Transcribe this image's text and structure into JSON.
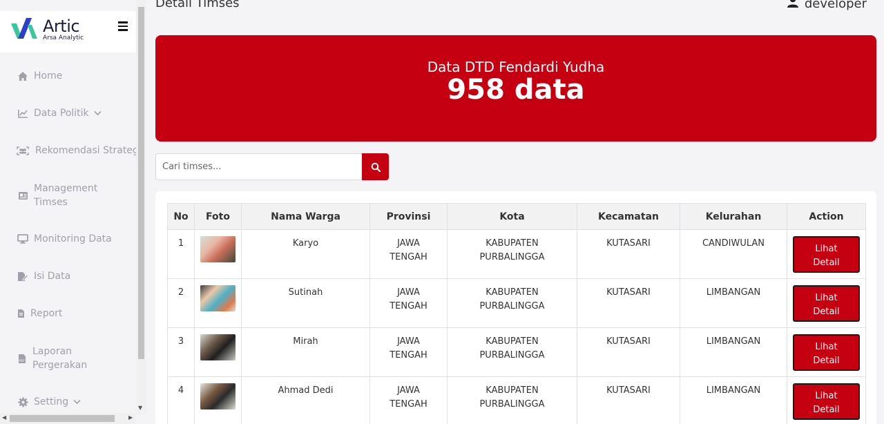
{
  "brand": {
    "name": "Artic",
    "subtitle": "Arsa Analytic"
  },
  "sidebar": {
    "items": [
      {
        "label": "Home",
        "icon": "home-icon"
      },
      {
        "label": "Data Politik",
        "icon": "chart-line-icon",
        "has_dropdown": true
      },
      {
        "label": "Rekomendasi Strategi",
        "icon": "users-scan-icon"
      },
      {
        "label": "Management Timses",
        "icon": "id-card-icon"
      },
      {
        "label": "Monitoring Data",
        "icon": "monitor-icon"
      },
      {
        "label": "Isi Data",
        "icon": "file-edit-icon"
      },
      {
        "label": "Report",
        "icon": "file-icon"
      },
      {
        "label": "Laporan Pergerakan",
        "icon": "pdf-file-icon"
      },
      {
        "label": "Setting",
        "icon": "gear-icon",
        "has_dropdown": true
      }
    ]
  },
  "header": {
    "title": "Detail Timses",
    "user": "developer"
  },
  "banner": {
    "title": "Data DTD Fendardi Yudha",
    "count": "958 data"
  },
  "search": {
    "placeholder": "Cari timses..."
  },
  "table": {
    "headers": [
      "No",
      "Foto",
      "Nama Warga",
      "Provinsi",
      "Kota",
      "Kecamatan",
      "Kelurahan",
      "Action"
    ],
    "rows": [
      {
        "no": "1",
        "nama": "Karyo",
        "provinsi": "JAWA TENGAH",
        "kota": "KABUPATEN PURBALINGGA",
        "kecamatan": "KUTASARI",
        "kelurahan": "CANDIWULAN",
        "action": "Lihat Detail"
      },
      {
        "no": "2",
        "nama": "Sutinah",
        "provinsi": "JAWA TENGAH",
        "kota": "KABUPATEN PURBALINGGA",
        "kecamatan": "KUTASARI",
        "kelurahan": "LIMBANGAN",
        "action": "Lihat Detail"
      },
      {
        "no": "3",
        "nama": "Mirah",
        "provinsi": "JAWA TENGAH",
        "kota": "KABUPATEN PURBALINGGA",
        "kecamatan": "KUTASARI",
        "kelurahan": "LIMBANGAN",
        "action": "Lihat Detail"
      },
      {
        "no": "4",
        "nama": "Ahmad Dedi",
        "provinsi": "JAWA TENGAH",
        "kota": "KABUPATEN PURBALINGGA",
        "kecamatan": "KUTASARI",
        "kelurahan": "LIMBANGAN",
        "action": "Lihat Detail"
      }
    ]
  },
  "colors": {
    "accent": "#c50010",
    "sidebar_text": "#a0a0a8",
    "background": "#f4f4f7"
  }
}
